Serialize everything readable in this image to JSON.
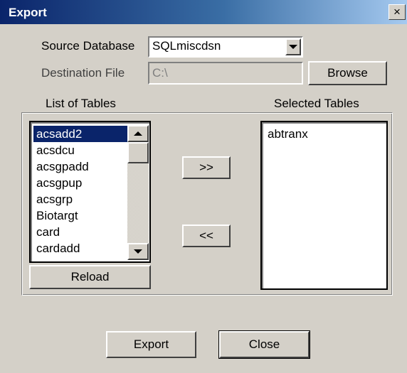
{
  "window": {
    "title": "Export",
    "close_glyph": "×"
  },
  "source": {
    "label": "Source Database",
    "value": "SQLmiscdsn"
  },
  "destination": {
    "label": "Destination File",
    "value": "C:\\",
    "browse_label": "Browse"
  },
  "list_tables": {
    "header": "List of Tables",
    "items": [
      "acsadd2",
      "acsdcu",
      "acsgpadd",
      "acsgpup",
      "acsgrp",
      "Biotargt",
      "card",
      "cardadd"
    ],
    "selected_index": 0,
    "reload_label": "Reload"
  },
  "transfer": {
    "add_label": ">>",
    "remove_label": "<<"
  },
  "selected_tables": {
    "header": "Selected Tables",
    "items": [
      "abtranx"
    ]
  },
  "footer": {
    "export_label": "Export",
    "close_label": "Close"
  }
}
